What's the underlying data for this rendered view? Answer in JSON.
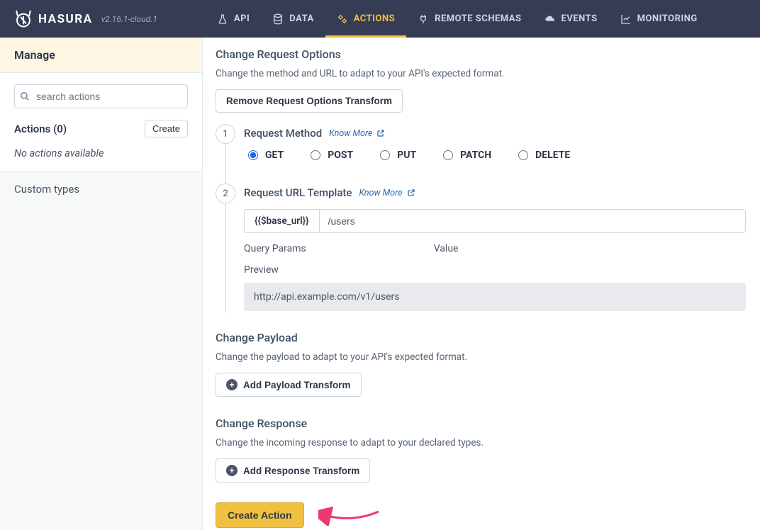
{
  "navbar": {
    "brand": "HASURA",
    "version": "v2.16.1-cloud.1",
    "items": [
      {
        "label": "API",
        "active": false
      },
      {
        "label": "DATA",
        "active": false
      },
      {
        "label": "ACTIONS",
        "active": true
      },
      {
        "label": "REMOTE SCHEMAS",
        "active": false
      },
      {
        "label": "EVENTS",
        "active": false
      },
      {
        "label": "MONITORING",
        "active": false
      }
    ]
  },
  "sidebar": {
    "manage_label": "Manage",
    "search_placeholder": "search actions",
    "actions_count_label": "Actions (0)",
    "create_label": "Create",
    "empty_label": "No actions available",
    "custom_types_label": "Custom types"
  },
  "main": {
    "request_options": {
      "title": "Change Request Options",
      "desc": "Change the method and URL to adapt to your API's expected format.",
      "remove_button": "Remove Request Options Transform"
    },
    "step1": {
      "number": "1",
      "title": "Request Method",
      "know_more": "Know More",
      "methods": [
        "GET",
        "POST",
        "PUT",
        "PATCH",
        "DELETE"
      ],
      "selected": "GET"
    },
    "step2": {
      "number": "2",
      "title": "Request URL Template",
      "know_more": "Know More",
      "prefix": "{{$base_url}}",
      "url_value": "/users",
      "query_params_label": "Query Params",
      "value_label": "Value",
      "preview_label": "Preview",
      "preview_value": "http://api.example.com/v1/users"
    },
    "payload": {
      "title": "Change Payload",
      "desc": "Change the payload to adapt to your API's expected format.",
      "button": "Add Payload Transform"
    },
    "response": {
      "title": "Change Response",
      "desc": "Change the incoming response to adapt to your declared types.",
      "button": "Add Response Transform"
    },
    "create_button": "Create Action"
  }
}
